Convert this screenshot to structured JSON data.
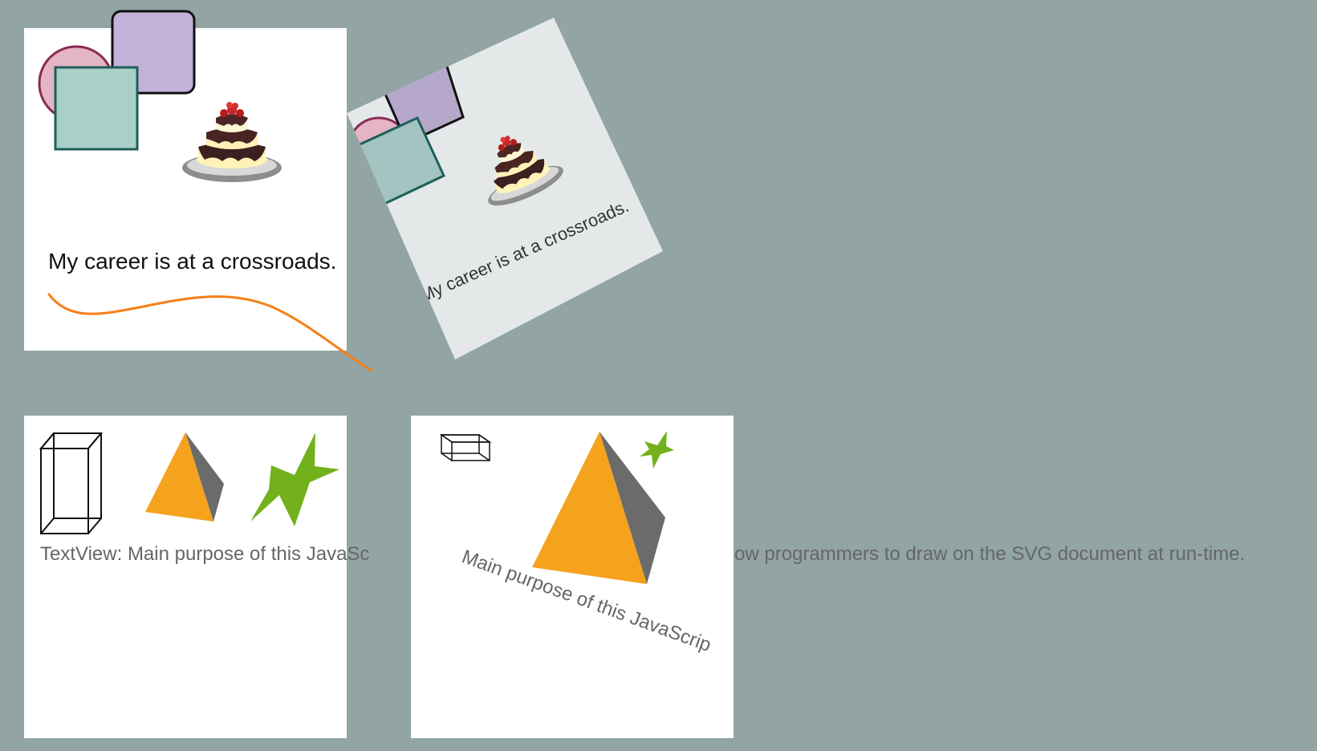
{
  "top_left_panel": {
    "caption": "My career is at a crossroads."
  },
  "rotated_panel": {
    "caption": "My career is at a crossroads."
  },
  "bottom_text": {
    "left_segment": "TextView: Main purpose of this JavaSc",
    "right_segment": "ow programmers to draw on the SVG document at run-time.",
    "rotated_segment": "Main purpose of this JavaScrip"
  },
  "colors": {
    "background": "#92a4a4",
    "panel": "#ffffff",
    "rotated_panel": "#e4e8e8",
    "circle_fill": "#e4b5c4",
    "circle_stroke": "#8a2a55",
    "purple_square_fill": "#c2b1d8",
    "purple_square_stroke": "#111111",
    "teal_square_fill": "#a9cfc9",
    "teal_square_stroke": "#1f5f5a",
    "curve": "#f57f17",
    "pyramid_front": "#f5a31d",
    "pyramid_side": "#6b6b6b",
    "star": "#72b11b",
    "text_gray": "#666666"
  },
  "icons": [
    "cake-icon",
    "wireframe-box-icon",
    "pyramid-icon",
    "star-icon"
  ]
}
